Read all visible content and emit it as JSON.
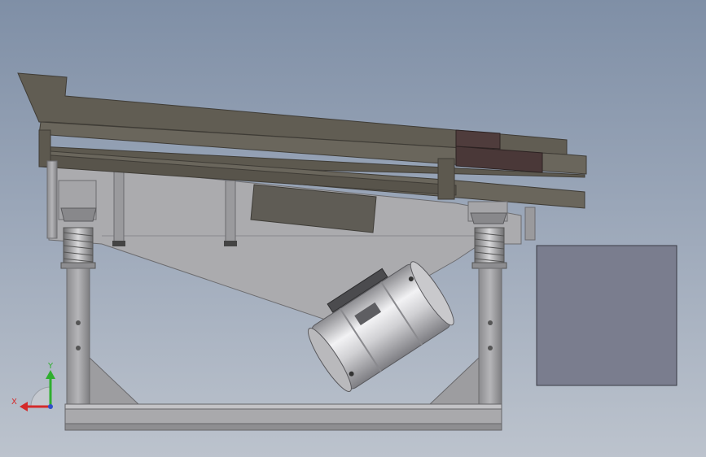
{
  "triad": {
    "x_label": "X",
    "y_label": "Y",
    "x_color": "#d42a2a",
    "y_color": "#2fae2f",
    "z_color": "#3050c8"
  },
  "colors": {
    "background_top": "#7f8fa6",
    "background_bottom": "#bcc3cd",
    "screen_box": "#5f5a50",
    "screen_dark": "#4e4a42",
    "screen_maroon": "#4f3c3c",
    "frame_gray": "#a8a8ab",
    "frame_dark": "#77777a",
    "motor_silver": "#d6d6d8",
    "control_panel": "#7a7d8e",
    "spring": "#9a9a9a"
  },
  "parts": {
    "vibrating_screen_box": "vibrating-screen-box",
    "feed_inlet": "feed-inlet",
    "vibration_motor": "vibration-motor",
    "support_springs": "support-springs",
    "base_frame": "base-frame",
    "control_panel": "control-panel"
  }
}
